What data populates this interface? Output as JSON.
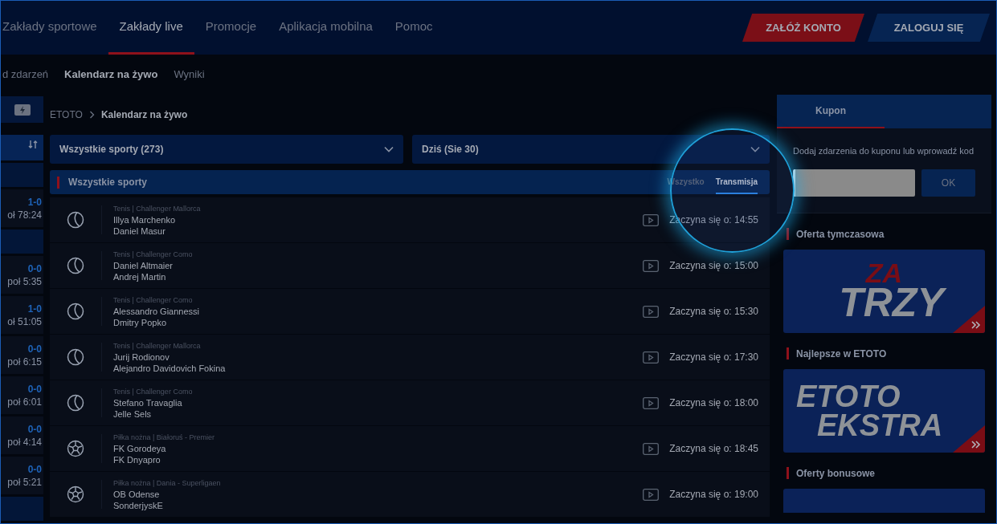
{
  "nav": {
    "items": [
      {
        "label": "Zakłady sportowe",
        "selected": false
      },
      {
        "label": "Zakłady live",
        "selected": true
      },
      {
        "label": "Promocje",
        "selected": false
      },
      {
        "label": "Aplikacja mobilna",
        "selected": false
      },
      {
        "label": "Pomoc",
        "selected": false
      }
    ],
    "buttons": [
      {
        "label": "ZAŁÓŻ KONTO",
        "kind": "register"
      },
      {
        "label": "ZALOGUJ SIĘ",
        "kind": "login"
      }
    ]
  },
  "subnav": [
    {
      "label": "d zdarzeń",
      "selected": false
    },
    {
      "label": "Kalendarz na żywo",
      "selected": true
    },
    {
      "label": "Wyniki",
      "selected": false
    }
  ],
  "sidebar": {
    "items": [
      {
        "kind": "live"
      },
      {
        "kind": "sort"
      },
      {
        "kind": "header"
      },
      {
        "kind": "score",
        "score": "1-0",
        "time": "oł 78:24"
      },
      {
        "kind": "header"
      },
      {
        "kind": "score",
        "score": "0-0",
        "time": "poł 5:35"
      },
      {
        "kind": "score",
        "score": "1-0",
        "time": "oł 51:05"
      },
      {
        "kind": "score",
        "score": "0-0",
        "time": "poł 6:15"
      },
      {
        "kind": "score",
        "score": "0-0",
        "time": "poł 6:01"
      },
      {
        "kind": "score",
        "score": "0-0",
        "time": "poł 4:14"
      },
      {
        "kind": "score",
        "score": "0-0",
        "time": "poł 5:21"
      },
      {
        "kind": "header"
      }
    ]
  },
  "breadcrumb": [
    "ETOTO",
    "Kalendarz na żywo"
  ],
  "filters": [
    "Wszystkie sporty (273)",
    "Dziś (Sie 30)"
  ],
  "list": {
    "title": "Wszystkie sporty",
    "tabs": [
      {
        "label": "Wszystko",
        "selected": false
      },
      {
        "label": "Transmisja",
        "selected": true
      }
    ],
    "rows": [
      {
        "kind": "tennis",
        "league": "Tenis | Challenger Mallorca",
        "home": "Illya Marchenko",
        "away": "Daniel Masur",
        "start": "Zaczyna się o: 14:55"
      },
      {
        "kind": "tennis",
        "league": "Tenis | Challenger Como",
        "home": "Daniel Altmaier",
        "away": "Andrej Martin",
        "start": "Zaczyna się o: 15:00"
      },
      {
        "kind": "tennis",
        "league": "Tenis | Challenger Como",
        "home": "Alessandro Giannessi",
        "away": "Dmitry Popko",
        "start": "Zaczyna się o: 15:30"
      },
      {
        "kind": "tennis",
        "league": "Tenis | Challenger Mallorca",
        "home": "Jurij Rodionov",
        "away": "Alejandro Davidovich Fokina",
        "start": "Zaczyna się o: 17:30"
      },
      {
        "kind": "tennis",
        "league": "Tenis | Challenger Como",
        "home": "Stefano Travaglia",
        "away": "Jelle Sels",
        "start": "Zaczyna się o: 18:00"
      },
      {
        "kind": "football",
        "league": "Piłka nożna | Białoruś - Premier",
        "home": "FK Gorodeya",
        "away": "FK Dnyapro",
        "start": "Zaczyna się o: 18:45"
      },
      {
        "kind": "football",
        "league": "Piłka nożna | Dania - Superligaen",
        "home": "OB Odense",
        "away": "SonderjyskE",
        "start": "Zaczyna się o: 19:00"
      }
    ]
  },
  "coupon": {
    "tab": {
      "label": "Kupon",
      "selected": true
    },
    "hint": "Dodaj zdarzenia do kuponu lub wprowadź kod",
    "button": "OK"
  },
  "promos": [
    {
      "title": "Oferta tymczasowa",
      "banner": [
        "ZA",
        "TRZY"
      ],
      "kind": "zatrzy"
    },
    {
      "title": "Najlepsze w ETOTO",
      "banner": [
        "ETOTO",
        "EKSTRA"
      ],
      "kind": "ekstra"
    },
    {
      "title": "Oferty bonusowe",
      "kind": "bonus"
    }
  ]
}
